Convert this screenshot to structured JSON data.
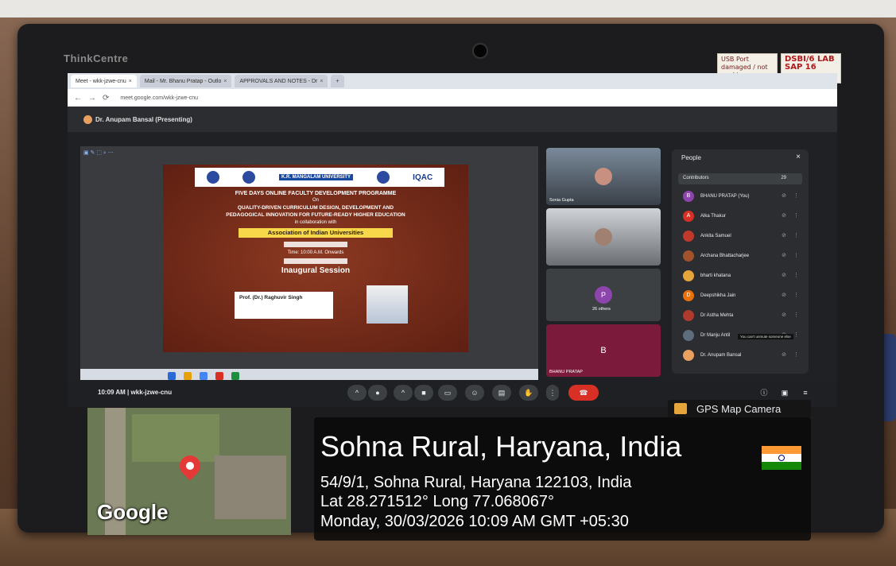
{
  "monitor": {
    "brand": "ThinkCentre",
    "sticky1": "USB Port damaged / not working",
    "sticky2": "DSBI/6 LAB SAP 16"
  },
  "browser": {
    "tabs": [
      {
        "label": "Meet - wkk-jzwe-cnu",
        "active": true
      },
      {
        "label": "Mail - Mr. Bhanu Pratap - Outlo",
        "active": false
      },
      {
        "label": "APPROVALS AND NOTES - Dr",
        "active": false
      }
    ],
    "url": "meet.google.com/wkk-jzwe-cnu"
  },
  "meet": {
    "presenter": "Dr. Anupam Bansal (Presenting)",
    "slide": {
      "university": "K.R. MANGALAM UNIVERSITY",
      "iqac": "IQAC",
      "line1": "FIVE DAYS ONLINE FACULTY DEVELOPMENT PROGRAMME",
      "on": "On",
      "line2a": "QUALITY-DRIVEN CURRICULUM DESIGN, DEVELOPMENT AND",
      "line2b": "PEDAGOGICAL INNOVATION FOR FUTURE-READY HIGHER EDUCATION",
      "collab": "in collaboration with",
      "aiu": "Association of Indian Universities",
      "time": "Time: 10:00 A.M. Onwards",
      "session": "Inaugural Session",
      "speaker": "Prof. (Dr.) Raghuvir Singh"
    },
    "tiles": [
      {
        "label": "Sonia Gupta"
      },
      {
        "label": ""
      },
      {
        "label": "26 others"
      },
      {
        "label": "BHANU PRATAP",
        "initial": "B"
      }
    ],
    "people": {
      "title": "People",
      "contributors_label": "Contributors",
      "contributors_count": "29",
      "list": [
        {
          "name": "BHANU PRATAP (You)",
          "initial": "B",
          "color": "#8e44ad"
        },
        {
          "name": "Alka Thakur",
          "initial": "A",
          "color": "#d93025"
        },
        {
          "name": "Ankita Samuel",
          "initial": "",
          "color": "#c0392b"
        },
        {
          "name": "Archana Bhattacharjee",
          "initial": "",
          "color": "#a0522d"
        },
        {
          "name": "bharti khatana",
          "initial": "",
          "color": "#e6a53a"
        },
        {
          "name": "Deepshikha Jain",
          "initial": "D",
          "color": "#e8710a"
        },
        {
          "name": "Dr Astha Mehta",
          "initial": "",
          "color": "#b03a2e"
        },
        {
          "name": "Dr Manju Antil",
          "initial": "",
          "color": "#5d6d7e"
        },
        {
          "name": "Dr. Anupam Bansal",
          "initial": "",
          "color": "#e8a060"
        }
      ],
      "tooltip": "You can't unmute someone else"
    },
    "time": "10:09 AM",
    "meeting_code": "wkk-jzwe-cnu"
  },
  "overlay": {
    "app": "GPS Map Camera",
    "place": "Sohna Rural, Haryana, India",
    "address": "54/9/1, Sohna Rural, Haryana 122103, India",
    "coords": "Lat 28.271512° Long 77.068067°",
    "datetime": "Monday, 30/03/2026 10:09 AM GMT +05:30",
    "map_brand": "Google"
  }
}
